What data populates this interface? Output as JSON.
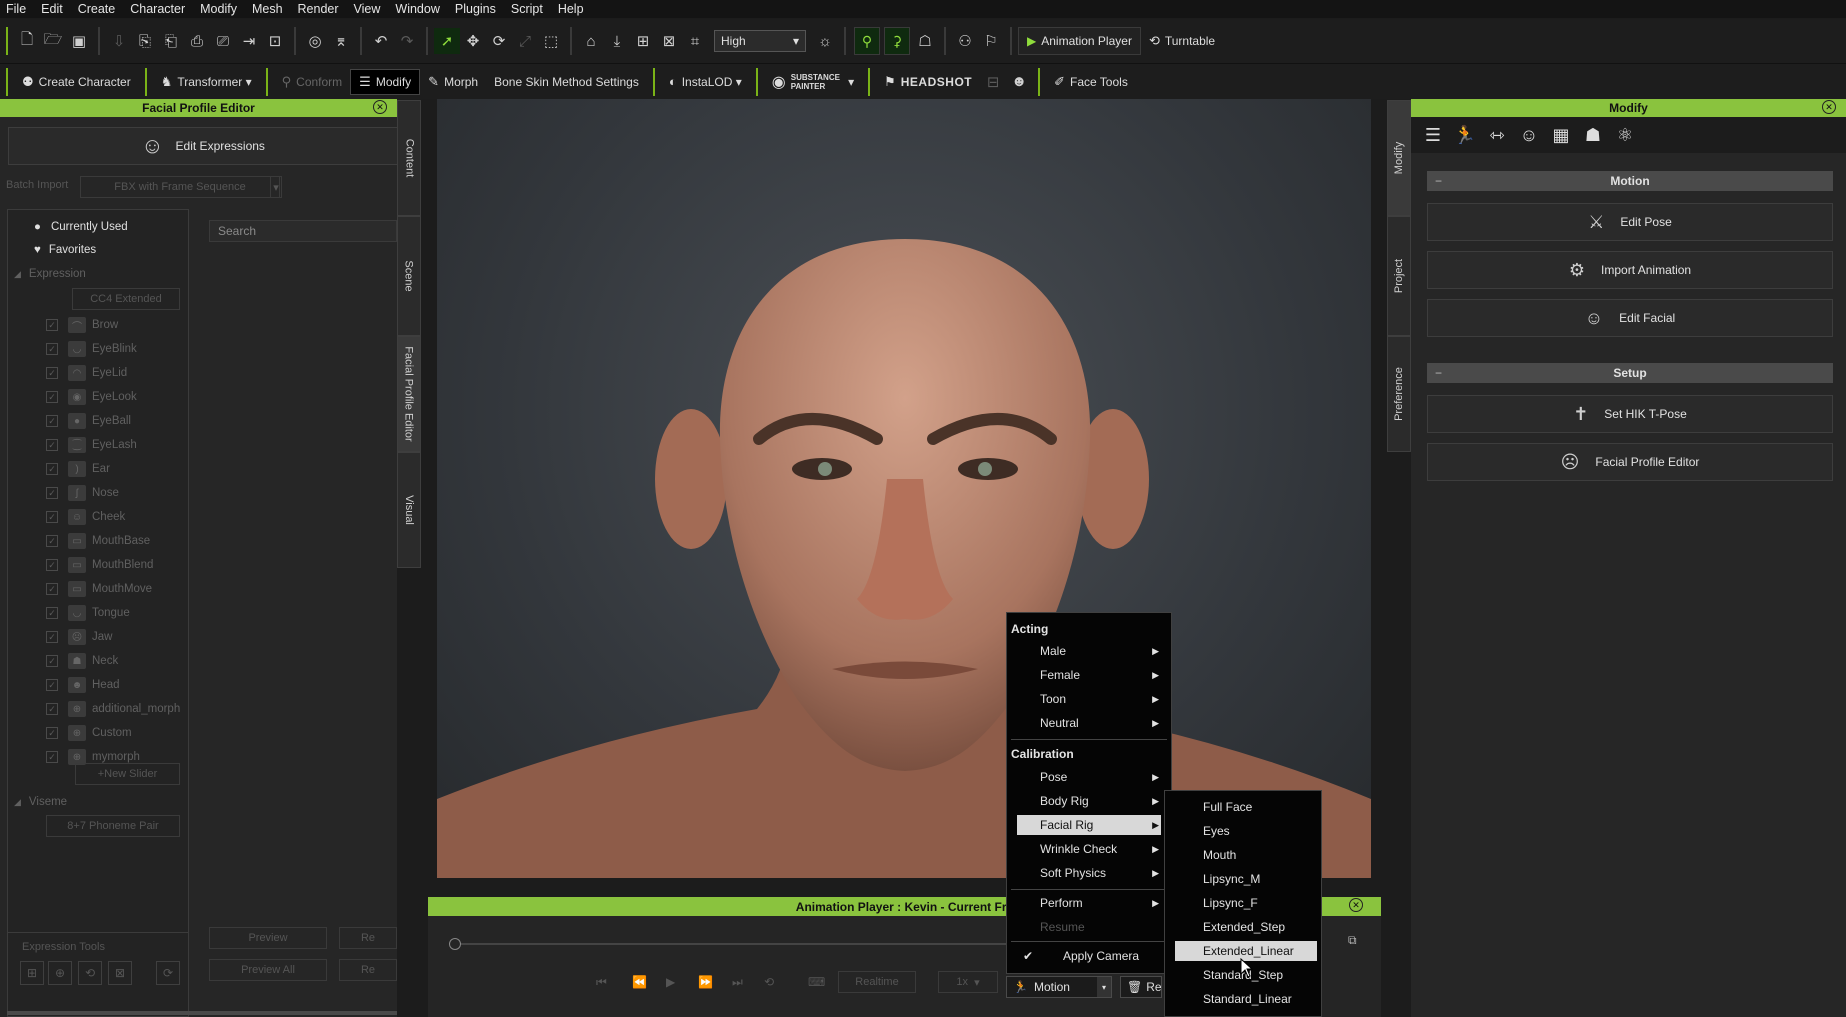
{
  "menubar": [
    "File",
    "Edit",
    "Create",
    "Character",
    "Modify",
    "Mesh",
    "Render",
    "View",
    "Window",
    "Plugins",
    "Script",
    "Help"
  ],
  "toolbar1": {
    "quality": "High",
    "animation_player": "Animation Player",
    "turntable": "Turntable"
  },
  "toolbar2": {
    "create_character": "Create Character",
    "transformer": "Transformer",
    "conform": "Conform",
    "modify": "Modify",
    "morph": "Morph",
    "bone_skin": "Bone Skin Method Settings",
    "instalod": "InstaLOD",
    "substance": "SUBSTANCE PAINTER",
    "headshot": "HEADSHOT",
    "face_tools": "Face Tools"
  },
  "left_panel": {
    "title": "Facial Profile Editor",
    "edit_expressions": "Edit Expressions",
    "batch_import": "Batch Import",
    "batch_option": "FBX with Frame Sequence",
    "search_placeholder": "Search",
    "currently_used": "Currently Used",
    "favorites": "Favorites",
    "expression": "Expression",
    "cc4_extended": "CC4 Extended",
    "items": [
      "Brow",
      "EyeBlink",
      "EyeLid",
      "EyeLook",
      "EyeBall",
      "EyeLash",
      "Ear",
      "Nose",
      "Cheek",
      "MouthBase",
      "MouthBlend",
      "MouthMove",
      "Tongue",
      "Jaw",
      "Neck",
      "Head",
      "additional_morph",
      "Custom",
      "mymorph"
    ],
    "new_slider": "New Slider",
    "viseme": "Viseme",
    "phoneme": "8+7 Phoneme Pair",
    "expression_tools": "Expression Tools",
    "preview": "Preview",
    "preview_all": "Preview All",
    "re1": "Re",
    "re2": "Re"
  },
  "side_tabs_left": [
    "Content",
    "Scene",
    "Facial Profile Editor",
    "Visual"
  ],
  "side_tabs_right": [
    "Modify",
    "Project",
    "Preference"
  ],
  "right_panel": {
    "title": "Modify",
    "motion": "Motion",
    "edit_pose": "Edit Pose",
    "import_animation": "Import Animation",
    "edit_facial": "Edit Facial",
    "setup": "Setup",
    "set_hik": "Set HIK T-Pose",
    "facial_profile_editor": "Facial Profile Editor"
  },
  "anim_player": {
    "title": "Animation Player : Kevin - Current Fra",
    "realtime": "Realtime",
    "speed": "1x",
    "motion": "Motion",
    "reset": "Re"
  },
  "context_menu": {
    "acting": "Acting",
    "acting_items": [
      "Male",
      "Female",
      "Toon",
      "Neutral"
    ],
    "calibration": "Calibration",
    "calibration_items": [
      "Pose",
      "Body Rig",
      "Facial Rig",
      "Wrinkle Check",
      "Soft Physics"
    ],
    "perform": "Perform",
    "resume": "Resume",
    "apply_camera": "Apply Camera"
  },
  "submenu": [
    "Full Face",
    "Eyes",
    "Mouth",
    "Lipsync_M",
    "Lipsync_F",
    "Extended_Step",
    "Extended_Linear",
    "Standard_Step",
    "Standard_Linear"
  ]
}
